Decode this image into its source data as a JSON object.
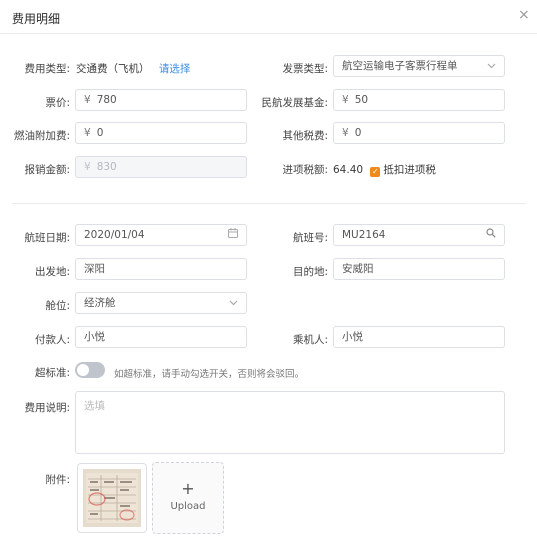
{
  "dialog": {
    "title": "费用明细",
    "close_icon": "×"
  },
  "expense": {
    "type_label": "费用类型:",
    "type_value": "交通费（飞机）",
    "reselect": "请选择",
    "invoice_type_label": "发票类型:",
    "invoice_type_value": "航空运输电子客票行程单",
    "fare_label": "票价:",
    "fare_value": "780",
    "dev_fund_label": "民航发展基金:",
    "dev_fund_value": "50",
    "fuel_label": "燃油附加费:",
    "fuel_value": "0",
    "other_tax_label": "其他税费:",
    "other_tax_value": "0",
    "reimb_label": "报销金额:",
    "reimb_value": "830",
    "input_tax_label": "进项税额:",
    "input_tax_value": "64.40",
    "deduct_label": "抵扣进项税",
    "deduct_checked": true,
    "currency": "¥"
  },
  "flight": {
    "date_label": "航班日期:",
    "date_value": "2020/01/04",
    "no_label": "航班号:",
    "no_value": "MU2164",
    "from_label": "出发地:",
    "from_value": "深阳",
    "to_label": "目的地:",
    "to_value": "安威阳",
    "cabin_label": "舱位:",
    "cabin_value": "经济舱",
    "payer_label": "付款人:",
    "payer_value": "小悦",
    "passenger_label": "乘机人:",
    "passenger_value": "小悦",
    "over_label": "超标准:",
    "over_enabled": false,
    "over_hint": "如超标准，请手动勾选开关，否则将会驳回。",
    "desc_label": "费用说明:",
    "desc_placeholder": "选填",
    "attach_label": "附件:",
    "upload_label": "Upload",
    "upload_plus": "+"
  },
  "icons": {
    "dropdown": "chevron-down-icon",
    "calendar": "calendar-icon",
    "search": "search-icon",
    "check": "check-icon"
  }
}
